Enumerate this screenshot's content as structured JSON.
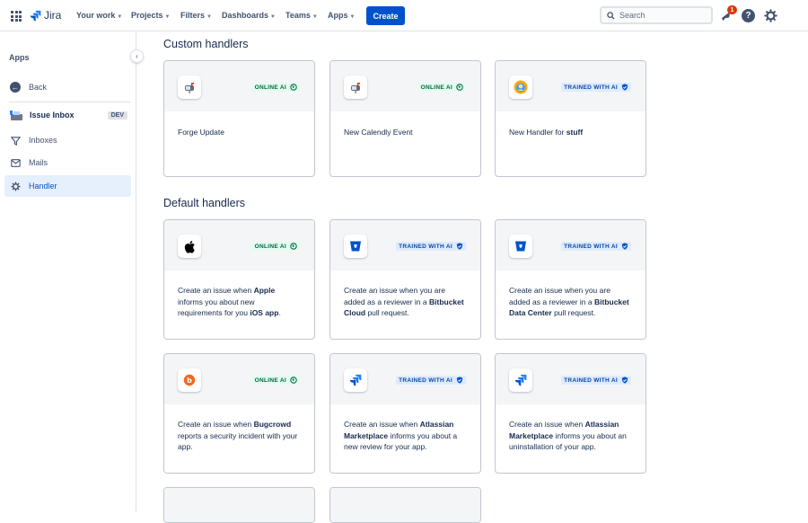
{
  "nav": {
    "logo_text": "Jira",
    "items": [
      "Your work",
      "Projects",
      "Filters",
      "Dashboards",
      "Teams",
      "Apps"
    ],
    "create_label": "Create",
    "search_placeholder": "Search",
    "notification_count": "1"
  },
  "sidebar": {
    "title": "Apps",
    "back_label": "Back",
    "project_name": "Issue Inbox",
    "project_badge": "DEV",
    "items": [
      {
        "label": "Inboxes",
        "icon": "inbox-icon"
      },
      {
        "label": "Mails",
        "icon": "mail-icon"
      },
      {
        "label": "Handler",
        "icon": "gear-icon",
        "active": true
      }
    ]
  },
  "custom_title": "Custom handlers",
  "default_title": "Default handlers",
  "tags": {
    "online": "ONLINE AI",
    "trained": "TRAINED WITH AI"
  },
  "custom_handlers": [
    {
      "title": "Forge Update",
      "tag": "online",
      "icon": "mailbox-icon"
    },
    {
      "title": "New Calendly Event",
      "tag": "online",
      "icon": "mailbox-icon"
    },
    {
      "title_prefix": "New Handler for ",
      "title_bold": "stuff",
      "tag": "trained",
      "icon": "avatar-icon"
    }
  ],
  "default_handlers": [
    {
      "parts": [
        "Create an issue when ",
        "Apple",
        " informs you about new requirements for you ",
        "iOS app",
        "."
      ],
      "tag": "online",
      "icon": "apple-icon"
    },
    {
      "parts": [
        "Create an issue when you are added as a reviewer in a ",
        "Bitbucket Cloud",
        " pull request."
      ],
      "tag": "trained",
      "icon": "bitbucket-icon"
    },
    {
      "parts": [
        "Create an issue when you are added as a reviewer in a ",
        "Bitbucket Data Center",
        " pull request."
      ],
      "tag": "trained",
      "icon": "bitbucket-icon"
    },
    {
      "parts": [
        "Create an issue when ",
        "Bugcrowd",
        " reports a security incident with your app."
      ],
      "tag": "online",
      "icon": "bugcrowd-icon"
    },
    {
      "parts": [
        "Create an issue when ",
        "Atlassian Marketplace",
        " informs you about a new review for your app."
      ],
      "tag": "trained",
      "icon": "marketplace-icon"
    },
    {
      "parts": [
        "Create an issue when ",
        "Atlassian Marketplace",
        " informs you about an uninstallation of your app."
      ],
      "tag": "trained",
      "icon": "marketplace-icon"
    }
  ],
  "colors": {
    "primary": "#0052cc",
    "online_text": "#006644",
    "trained_text": "#0747a6",
    "badge": "#de350b"
  }
}
